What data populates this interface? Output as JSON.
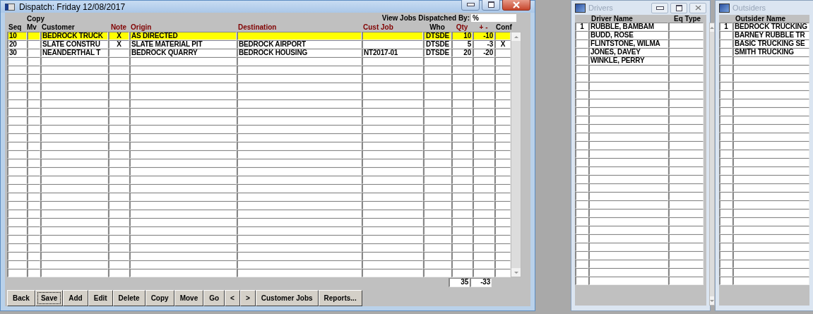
{
  "dispatch_window": {
    "title": "Dispatch: Friday 12/08/2017",
    "filter": {
      "label": "View Jobs Dispatched By:",
      "value": "%"
    },
    "columns": [
      {
        "label": "Seq",
        "color": "#000000"
      },
      {
        "label": "Mv",
        "over": "Copy",
        "color": "#000000"
      },
      {
        "label": "Customer",
        "color": "#000000"
      },
      {
        "label": "Note",
        "color": "#800000"
      },
      {
        "label": "Origin",
        "color": "#800000"
      },
      {
        "label": "Destination",
        "color": "#800000"
      },
      {
        "label": "Cust Job",
        "color": "#800000"
      },
      {
        "label": "Who",
        "color": "#000000"
      },
      {
        "label": "Qty",
        "color": "#800000"
      },
      {
        "label": "+ -",
        "color": "#800000"
      },
      {
        "label": "Conf",
        "color": "#000000"
      }
    ],
    "rows": [
      {
        "selected": true,
        "cells": [
          "10",
          "",
          "BEDROCK TRUCK",
          "X",
          "AS DIRECTED",
          "",
          "",
          "DTSDE",
          "10",
          "-10",
          ""
        ]
      },
      {
        "selected": false,
        "cells": [
          "20",
          "",
          "SLATE CONSTRU",
          "X",
          "SLATE MATERIAL PIT",
          "BEDROCK AIRPORT",
          "",
          "DTSDE",
          "5",
          "-3",
          "X"
        ]
      },
      {
        "selected": false,
        "cells": [
          "30",
          "",
          "NEANDERTHAL T",
          "",
          "BEDROCK QUARRY",
          "BEDROCK HOUSING",
          "NT2017-01",
          "DTSDE",
          "20",
          "-20",
          ""
        ]
      }
    ],
    "totals": {
      "qty": "35",
      "diff": "-33"
    },
    "buttons": [
      {
        "label": "Back",
        "focused": false
      },
      {
        "label": "Save",
        "focused": true
      },
      {
        "label": "Add",
        "focused": false
      },
      {
        "label": "Edit",
        "focused": false
      },
      {
        "label": "Delete",
        "focused": false
      },
      {
        "label": "Copy",
        "focused": false
      },
      {
        "label": "Move",
        "focused": false
      },
      {
        "label": "Go",
        "focused": false
      },
      {
        "label": "<",
        "focused": false
      },
      {
        "label": ">",
        "focused": false
      },
      {
        "label": "Customer Jobs",
        "focused": false
      },
      {
        "label": "Reports...",
        "focused": false
      }
    ]
  },
  "drivers_window": {
    "title": "Drivers",
    "columns": [
      "Driver Name",
      "Eq Type"
    ],
    "rows": [
      {
        "number": "1",
        "name": "RUBBLE, BAMBAM"
      },
      {
        "name": "BUDD, ROSE"
      },
      {
        "name": "FLINTSTONE, WILMA"
      },
      {
        "name": "JONES, DAVEY"
      },
      {
        "name": "WINKLE, PERRY"
      }
    ]
  },
  "outsiders_window": {
    "title": "Outsiders",
    "columns": [
      "Outsider Name"
    ],
    "rows": [
      {
        "number": "1",
        "name": "BEDROCK TRUCKING"
      },
      {
        "name": "BARNEY RUBBLE TR"
      },
      {
        "name": "BASIC TRUCKING SE"
      },
      {
        "name": "SMITH TRUCKING"
      }
    ]
  }
}
